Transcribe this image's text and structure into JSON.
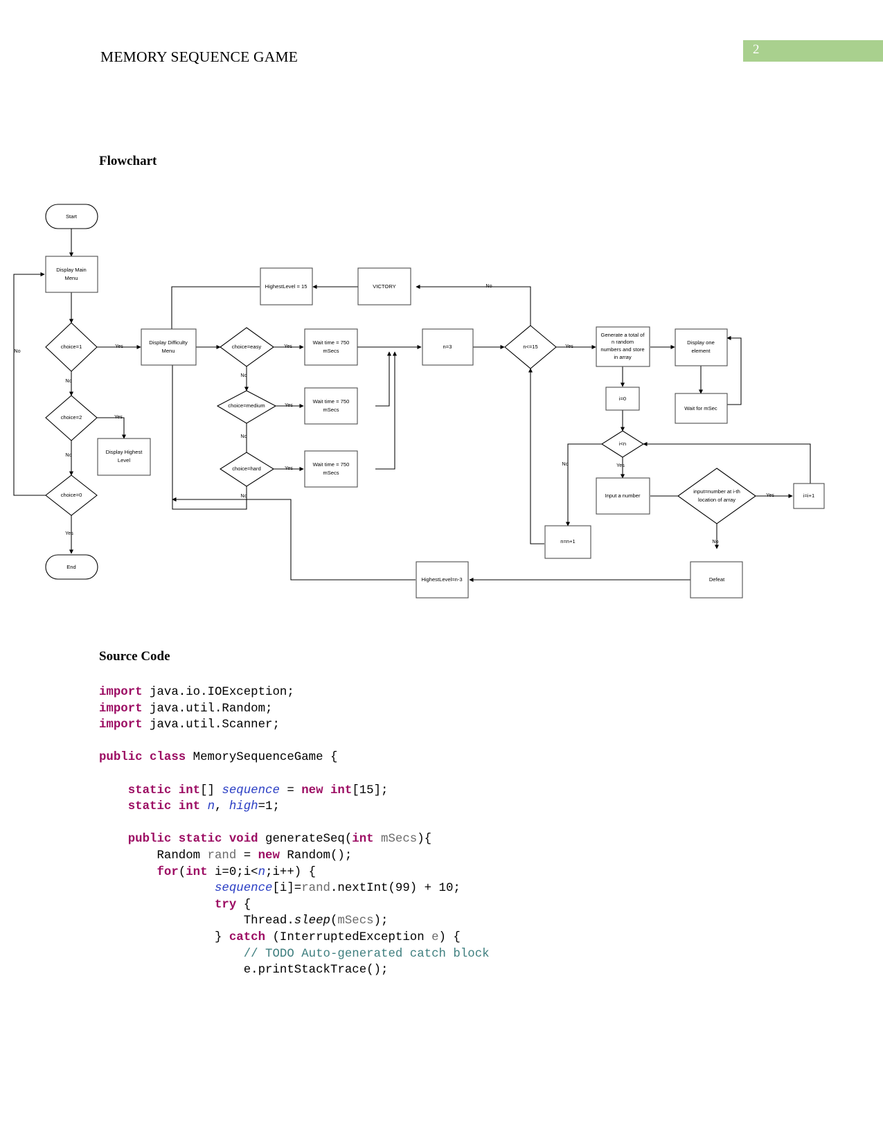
{
  "header": {
    "title": "MEMORY SEQUENCE GAME",
    "page_number": "2",
    "badge_color": "#a9d08e"
  },
  "sections": {
    "flowchart_heading": "Flowchart",
    "source_code_heading": "Source Code"
  },
  "flowchart": {
    "nodes": {
      "start": "Start",
      "display_main_menu": "Display Main\nMenu",
      "choice_1": "choice=1",
      "choice_2": "choice=2",
      "choice_0": "choice=0",
      "display_highest_level": "Display Highest\nLevel",
      "end": "End",
      "display_difficulty_menu": "Display Difficulty\nMenu",
      "choice_easy": "choice=easy",
      "choice_medium": "choice=medium",
      "choice_hard": "choice=hard",
      "wait_easy": "Wait time = 750\nmSecs",
      "wait_medium": "Wait time = 750\nmSecs",
      "wait_hard": "Wait time = 750\nmSecs",
      "n_equals_3": "n=3",
      "n_le_15": "n<=15",
      "victory": "VICTORY",
      "highest_level_15": "HighestLevel = 15",
      "generate_random": "Generate a total of\nn random\nnumbers and store\nin array",
      "i_equals_0": "i=0",
      "display_one_element": "Display one\nelement",
      "wait_for_msec": "Wait for mSec",
      "i_lt_n": "i<n",
      "input_a_number": "Input a number",
      "input_matches": "input=number at i-th\nlocation of array",
      "i_increment": "i=i+1",
      "n_increment": "n=n+1",
      "defeat": "Defeat",
      "highest_level_n3": "HighestLevel=n-3"
    },
    "edge_labels": {
      "yes": "Yes",
      "no": "No"
    }
  },
  "source_code": {
    "lines": [
      [
        {
          "t": "import",
          "c": "kw"
        },
        {
          "t": " java.io.IOException;",
          "c": "plain"
        }
      ],
      [
        {
          "t": "import",
          "c": "kw"
        },
        {
          "t": " java.util.Random;",
          "c": "plain"
        }
      ],
      [
        {
          "t": "import",
          "c": "kw"
        },
        {
          "t": " java.util.Scanner;",
          "c": "plain"
        }
      ],
      [
        {
          "t": "",
          "c": "plain"
        }
      ],
      [
        {
          "t": "public class",
          "c": "kw"
        },
        {
          "t": " MemorySequenceGame {",
          "c": "plain"
        }
      ],
      [
        {
          "t": "",
          "c": "plain"
        }
      ],
      [
        {
          "t": "    ",
          "c": "plain"
        },
        {
          "t": "static int",
          "c": "kw"
        },
        {
          "t": "[] ",
          "c": "plain"
        },
        {
          "t": "sequence",
          "c": "fld"
        },
        {
          "t": " = ",
          "c": "plain"
        },
        {
          "t": "new int",
          "c": "kw"
        },
        {
          "t": "[15];",
          "c": "plain"
        }
      ],
      [
        {
          "t": "    ",
          "c": "plain"
        },
        {
          "t": "static int",
          "c": "kw"
        },
        {
          "t": " ",
          "c": "plain"
        },
        {
          "t": "n",
          "c": "fld"
        },
        {
          "t": ", ",
          "c": "plain"
        },
        {
          "t": "high",
          "c": "fld"
        },
        {
          "t": "=1;",
          "c": "plain"
        }
      ],
      [
        {
          "t": "",
          "c": "plain"
        }
      ],
      [
        {
          "t": "    ",
          "c": "plain"
        },
        {
          "t": "public static void",
          "c": "kw"
        },
        {
          "t": " generateSeq(",
          "c": "plain"
        },
        {
          "t": "int",
          "c": "kw"
        },
        {
          "t": " ",
          "c": "plain"
        },
        {
          "t": "mSecs",
          "c": "loc"
        },
        {
          "t": "){",
          "c": "plain"
        }
      ],
      [
        {
          "t": "        Random ",
          "c": "plain"
        },
        {
          "t": "rand",
          "c": "loc"
        },
        {
          "t": " = ",
          "c": "plain"
        },
        {
          "t": "new",
          "c": "kw"
        },
        {
          "t": " Random();",
          "c": "plain"
        }
      ],
      [
        {
          "t": "        ",
          "c": "plain"
        },
        {
          "t": "for",
          "c": "kw"
        },
        {
          "t": "(",
          "c": "plain"
        },
        {
          "t": "int",
          "c": "kw"
        },
        {
          "t": " i=0;i<",
          "c": "plain"
        },
        {
          "t": "n",
          "c": "fld"
        },
        {
          "t": ";i++) {",
          "c": "plain"
        }
      ],
      [
        {
          "t": "                ",
          "c": "plain"
        },
        {
          "t": "sequence",
          "c": "fld"
        },
        {
          "t": "[i]=",
          "c": "plain"
        },
        {
          "t": "rand",
          "c": "loc"
        },
        {
          "t": ".nextInt(99) + 10;",
          "c": "plain"
        }
      ],
      [
        {
          "t": "                ",
          "c": "plain"
        },
        {
          "t": "try",
          "c": "kw"
        },
        {
          "t": " {",
          "c": "plain"
        }
      ],
      [
        {
          "t": "                    Thread.",
          "c": "plain"
        },
        {
          "t": "sleep",
          "c": "mth"
        },
        {
          "t": "(",
          "c": "plain"
        },
        {
          "t": "mSecs",
          "c": "loc"
        },
        {
          "t": ");",
          "c": "plain"
        }
      ],
      [
        {
          "t": "                } ",
          "c": "plain"
        },
        {
          "t": "catch",
          "c": "kw"
        },
        {
          "t": " (InterruptedException ",
          "c": "plain"
        },
        {
          "t": "e",
          "c": "loc"
        },
        {
          "t": ") {",
          "c": "plain"
        }
      ],
      [
        {
          "t": "                    ",
          "c": "plain"
        },
        {
          "t": "// ",
          "c": "cmt"
        },
        {
          "t": "TODO",
          "c": "cmt"
        },
        {
          "t": " Auto-generated catch block",
          "c": "cmt"
        }
      ],
      [
        {
          "t": "                    e.printStackTrace();",
          "c": "plain"
        }
      ]
    ]
  }
}
